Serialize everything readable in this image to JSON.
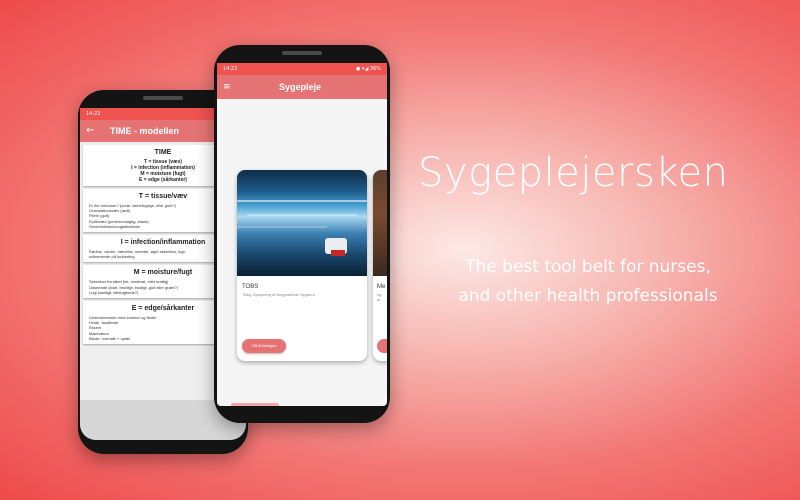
{
  "phone1": {
    "status_time": "14:22",
    "status_icons": "◐ ▼",
    "title": "TIME - modellen",
    "cards": [
      {
        "heading": "TIME",
        "lines": [
          "T = tissue (væv)",
          "I = infection (inflammation)",
          "M = moisture (fugt)",
          "E = edge (sårkanter)"
        ]
      },
      {
        "heading": "T = tissue/væv",
        "lines": [
          "Er der nekroser? (sorte, tørre/fugtige, eller gule?)",
          "Granulationsvæv (rødt)",
          "Fibrin (gult)",
          "Epitelvæv (perlemorsagtig, blank)",
          "Senebloteise/knogleblotteise"
        ]
      },
      {
        "heading": "I = infection/inflammation",
        "lines": [
          "Rødme, varme, hævelse, smerter, øget sekretion, lugt,",
          "udbredende på forbinding"
        ]
      },
      {
        "heading": "M = moisture/fugt",
        "lines": [
          "Sekretion fra såret (let, moderat, eller kraftig)",
          "Udseende (klart, brunligt, blodigt, gult eller grønt?)",
          "Lugt (sødligt, ildelugtende?)"
        ]
      },
      {
        "heading": "E = edge/sårkanter",
        "lines": [
          "Underminerede med lommer og fistler",
          "Hvide, skallende",
          "Eksem",
          "Maceration",
          "Blede: normale + opitel"
        ]
      }
    ]
  },
  "phone2": {
    "status_time": "14:22",
    "status_icons": "● ▾◢ 36%",
    "menu_icon": "≡",
    "title": "Sygepleje",
    "category": {
      "title": "TOBS",
      "subtitle": "Tidlig Opsporing af Begyndende Sygdom",
      "button": "Gå til kategori"
    },
    "next_category": {
      "title": "Me",
      "sub1": "ng",
      "sub2": "al"
    }
  },
  "promo": {
    "headline": "Sygeplejersken",
    "tagline_line1": "The best tool belt for nurses,",
    "tagline_line2": "and other health professionals"
  }
}
